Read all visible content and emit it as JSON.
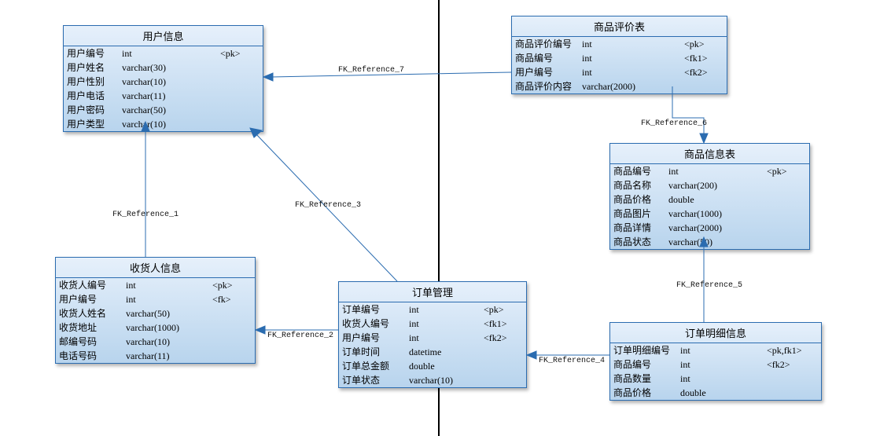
{
  "entities": {
    "user": {
      "title": "用户信息",
      "rows": [
        {
          "name": "用户编号",
          "type": "int",
          "key": "<pk>"
        },
        {
          "name": "用户姓名",
          "type": "varchar(30)",
          "key": ""
        },
        {
          "name": "用户性别",
          "type": "varchar(10)",
          "key": ""
        },
        {
          "name": "用户电话",
          "type": "varchar(11)",
          "key": ""
        },
        {
          "name": "用户密码",
          "type": "varchar(50)",
          "key": ""
        },
        {
          "name": "用户类型",
          "type": "varchar(10)",
          "key": ""
        }
      ]
    },
    "receiver": {
      "title": "收货人信息",
      "rows": [
        {
          "name": "收货人编号",
          "type": "int",
          "key": "<pk>"
        },
        {
          "name": "用户编号",
          "type": "int",
          "key": "<fk>"
        },
        {
          "name": "收货人姓名",
          "type": "varchar(50)",
          "key": ""
        },
        {
          "name": "收货地址",
          "type": "varchar(1000)",
          "key": ""
        },
        {
          "name": "邮编号码",
          "type": "varchar(10)",
          "key": ""
        },
        {
          "name": "电话号码",
          "type": "varchar(11)",
          "key": ""
        }
      ]
    },
    "order": {
      "title": "订单管理",
      "rows": [
        {
          "name": "订单编号",
          "type": "int",
          "key": "<pk>"
        },
        {
          "name": "收货人编号",
          "type": "int",
          "key": "<fk1>"
        },
        {
          "name": "用户编号",
          "type": "int",
          "key": "<fk2>"
        },
        {
          "name": "订单时间",
          "type": "datetime",
          "key": ""
        },
        {
          "name": "订单总金额",
          "type": "double",
          "key": ""
        },
        {
          "name": "订单状态",
          "type": "varchar(10)",
          "key": ""
        }
      ]
    },
    "review": {
      "title": "商品评价表",
      "rows": [
        {
          "name": "商品评价编号",
          "type": "int",
          "key": "<pk>"
        },
        {
          "name": "商品编号",
          "type": "int",
          "key": "<fk1>"
        },
        {
          "name": "用户编号",
          "type": "int",
          "key": "<fk2>"
        },
        {
          "name": "商品评价内容",
          "type": "varchar(2000)",
          "key": ""
        }
      ]
    },
    "product": {
      "title": "商品信息表",
      "rows": [
        {
          "name": "商品编号",
          "type": "int",
          "key": "<pk>"
        },
        {
          "name": "商品名称",
          "type": "varchar(200)",
          "key": ""
        },
        {
          "name": "商品价格",
          "type": "double",
          "key": ""
        },
        {
          "name": "商品图片",
          "type": "varchar(1000)",
          "key": ""
        },
        {
          "name": "商品详情",
          "type": "varchar(2000)",
          "key": ""
        },
        {
          "name": "商品状态",
          "type": "varchar(50)",
          "key": ""
        }
      ]
    },
    "orderdetail": {
      "title": "订单明细信息",
      "rows": [
        {
          "name": "订单明细编号",
          "type": "int",
          "key": "<pk,fk1>"
        },
        {
          "name": "商品编号",
          "type": "int",
          "key": "<fk2>"
        },
        {
          "name": "商品数量",
          "type": "int",
          "key": ""
        },
        {
          "name": "商品价格",
          "type": "double",
          "key": ""
        }
      ]
    }
  },
  "labels": {
    "ref1": "FK_Reference_1",
    "ref2": "FK_Reference_2",
    "ref3": "FK_Reference_3",
    "ref4": "FK_Reference_4",
    "ref5": "FK_Reference_5",
    "ref6": "FK_Reference_6",
    "ref7": "FK_Reference_7"
  }
}
